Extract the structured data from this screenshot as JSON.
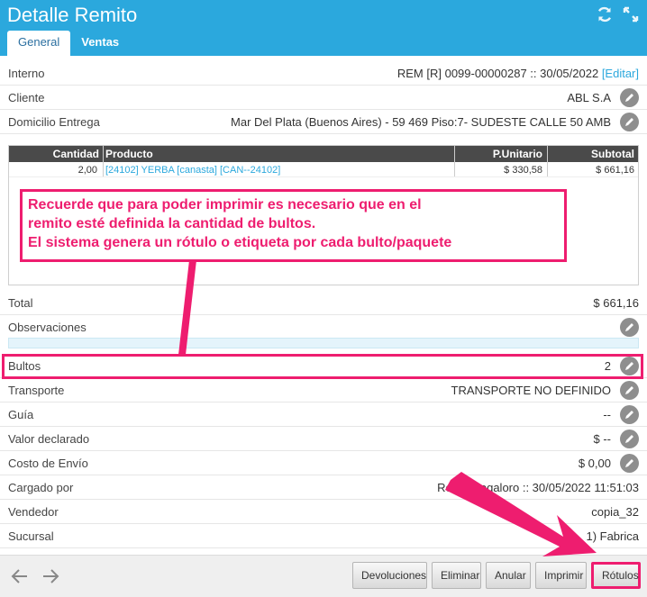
{
  "header": {
    "title": "Detalle Remito",
    "tabs": [
      "General",
      "Ventas"
    ]
  },
  "fields": {
    "interno": {
      "label": "Interno",
      "value": "REM [R] 0099-00000287 :: 30/05/2022",
      "edit_link": "[Editar]"
    },
    "cliente": {
      "label": "Cliente",
      "value": "ABL S.A"
    },
    "domicilio": {
      "label": "Domicilio Entrega",
      "value": "Mar Del Plata (Buenos Aires) - 59 469 Piso:7- SUDESTE CALLE 50 AMB"
    },
    "total": {
      "label": "Total",
      "value": "$ 661,16"
    },
    "observaciones": {
      "label": "Observaciones",
      "value": ""
    },
    "bultos": {
      "label": "Bultos",
      "value": "2"
    },
    "transporte": {
      "label": "Transporte",
      "value": "TRANSPORTE NO DEFINIDO"
    },
    "guia": {
      "label": "Guía",
      "value": "--"
    },
    "valor_declarado": {
      "label": "Valor declarado",
      "value": "$ --"
    },
    "costo_envio": {
      "label": "Costo de Envío",
      "value": "$ 0,00"
    },
    "cargado_por": {
      "label": "Cargado por",
      "value": "Renê Pregaloro :: 30/05/2022 11:51:03"
    },
    "vendedor": {
      "label": "Vendedor",
      "value": "copia_32"
    },
    "sucursal": {
      "label": "Sucursal",
      "value": "1) Fabrica"
    }
  },
  "items_table": {
    "headers": [
      "Cantidad",
      "Producto",
      "P.Unitario",
      "Subtotal"
    ],
    "rows": [
      {
        "cantidad": "2,00",
        "producto": "[24102] YERBA [canasta] [CAN--24102]",
        "unitario": "$ 330,58",
        "subtotal": "$ 661,16"
      }
    ]
  },
  "callout": {
    "lines": [
      "Recuerde que para poder imprimir es necesario que en el",
      "remito esté definida la cantidad de bultos.",
      "El sistema genera un rótulo o etiqueta por cada bulto/paquete"
    ]
  },
  "footer": {
    "buttons": [
      "Devoluciones",
      "Eliminar",
      "Anular",
      "Imprimir",
      "Rótulos"
    ]
  },
  "colors": {
    "header": "#2ba8dd",
    "accent": "#ee1d6f",
    "link": "#2ba8dd"
  },
  "icons": [
    "refresh-icon",
    "expand-icon",
    "pencil-icon",
    "arrow-left-icon",
    "arrow-right-icon"
  ]
}
